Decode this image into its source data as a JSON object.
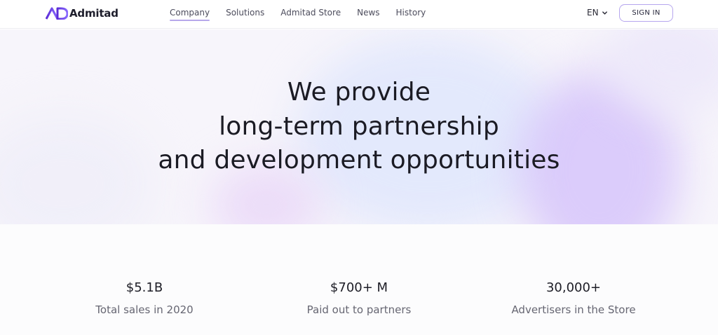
{
  "header": {
    "logo_text": "Admitad",
    "nav": [
      {
        "label": "Company",
        "active": true
      },
      {
        "label": "Solutions",
        "active": false
      },
      {
        "label": "Admitad Store",
        "active": false
      },
      {
        "label": "News",
        "active": false
      },
      {
        "label": "History",
        "active": false
      }
    ],
    "language": "EN",
    "signin_label": "SIGN IN"
  },
  "hero": {
    "title_lines": [
      "We provide",
      "long-term partnership",
      "and development opportunities"
    ]
  },
  "stats": [
    {
      "value": "$5.1B",
      "label": "Total sales in 2020"
    },
    {
      "value": "$700+ M",
      "label": "Paid out to partners"
    },
    {
      "value": "30,000+",
      "label": "Advertisers in the Store"
    }
  ],
  "colors": {
    "brand": "#7c5cff",
    "accent_underline": "#b7a8ea",
    "signin_border": "#b6a6ee",
    "text_dark": "#1b1b24",
    "text_muted": "#666672"
  },
  "icons": {
    "logo": "admitad-logo-icon",
    "language_chevron": "chevron-down-icon"
  }
}
